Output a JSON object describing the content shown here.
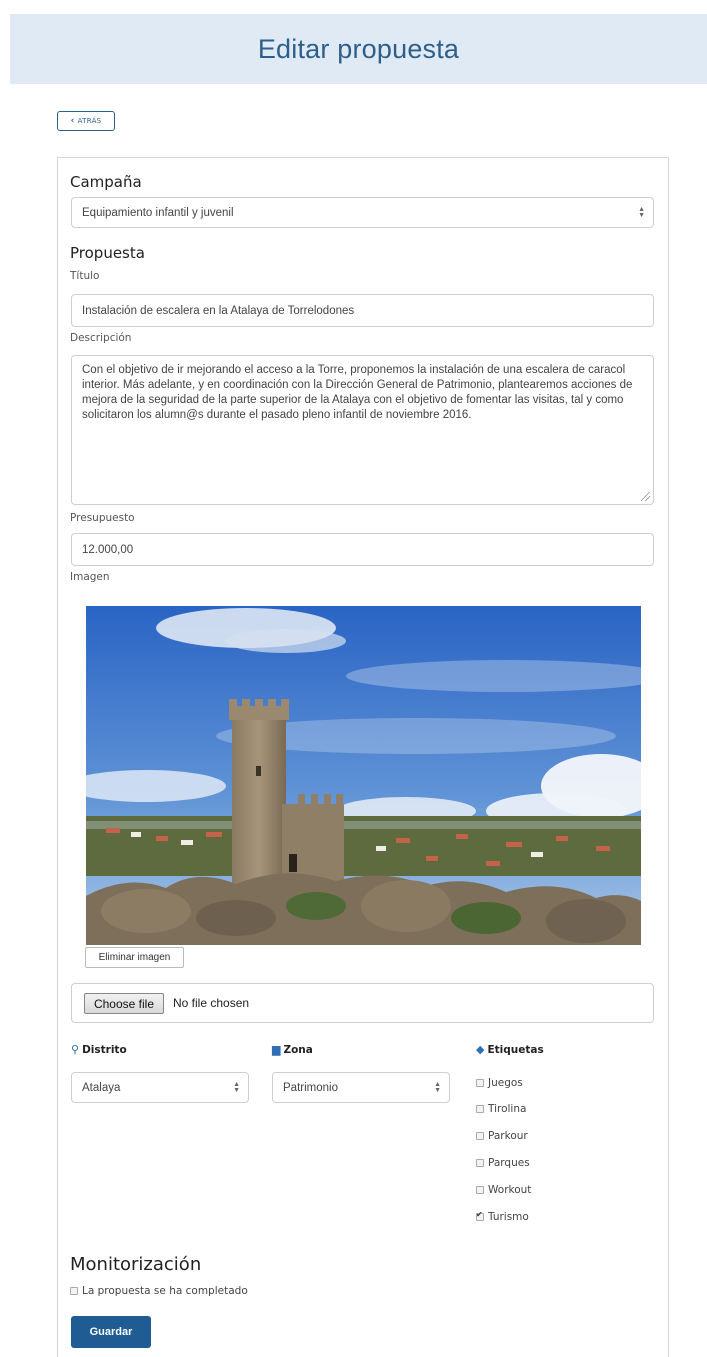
{
  "page": {
    "title": "Editar propuesta",
    "back_label": "ATRÁS"
  },
  "campaign": {
    "heading": "Campaña",
    "selected": "Equipamiento infantil y juvenil"
  },
  "proposal": {
    "heading": "Propuesta",
    "title_label": "Título",
    "title_value": "Instalación de escalera en la Atalaya de Torrelodones",
    "description_label": "Descripción",
    "description_value": "Con el objetivo de ir mejorando el acceso a la Torre, proponemos la instalación de una escalera de caracol interior. Más adelante, y en coordinación con la Dirección General de Patrimonio, plantearemos acciones de mejora de la seguridad de la parte superior de la Atalaya con el objetivo de fomentar las visitas, tal y como solicitaron los alumn@s durante el pasado pleno infantil de noviembre 2016.",
    "budget_label": "Presupuesto",
    "budget_value": "12.000,00",
    "image_label": "Imagen",
    "remove_image_label": "Eliminar imagen",
    "file": {
      "button_label": "Choose file",
      "status": "No file chosen"
    }
  },
  "district": {
    "label": "Distrito",
    "icon": "map-marker-icon",
    "selected": "Atalaya"
  },
  "zone": {
    "label": "Zona",
    "icon": "folder-icon",
    "selected": "Patrimonio"
  },
  "tags": {
    "label": "Etiquetas",
    "icon": "tag-icon",
    "items": [
      {
        "label": "Juegos",
        "checked": false
      },
      {
        "label": "Tirolina",
        "checked": false
      },
      {
        "label": "Parkour",
        "checked": false
      },
      {
        "label": "Parques",
        "checked": false
      },
      {
        "label": "Workout",
        "checked": false
      },
      {
        "label": "Turismo",
        "checked": true
      }
    ]
  },
  "monitoring": {
    "heading": "Monitorización",
    "completed_label": "La propuesta se ha completado",
    "completed": false
  },
  "actions": {
    "save_label": "Guardar"
  },
  "colors": {
    "header_bg": "#dfeaf5",
    "title": "#2e5f8a",
    "primary_button": "#1f5c94",
    "icon_blue": "#2f6fb3"
  }
}
